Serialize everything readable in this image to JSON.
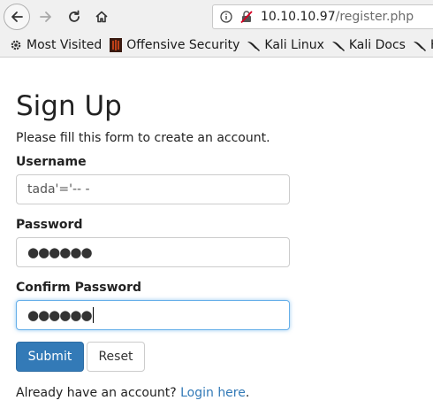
{
  "browser": {
    "url_host": "10.10.10.97",
    "url_path": "/register.php",
    "bookmarks": [
      {
        "label": "Most Visited",
        "icon": "gear-icon"
      },
      {
        "label": "Offensive Security",
        "icon": "offsec-icon"
      },
      {
        "label": "Kali Linux",
        "icon": "kali-dragon-icon"
      },
      {
        "label": "Kali Docs",
        "icon": "kali-dragon-icon"
      },
      {
        "label": "K",
        "icon": "kali-dragon-icon"
      }
    ]
  },
  "form": {
    "title": "Sign Up",
    "subtitle": "Please fill this form to create an account.",
    "username_label": "Username",
    "username_value": "tada'='-- -",
    "password_label": "Password",
    "password_value": "●●●●●●",
    "confirm_label": "Confirm Password",
    "confirm_value": "●●●●●●",
    "submit_label": "Submit",
    "reset_label": "Reset",
    "login_prompt": "Already have an account?",
    "login_link": "Login here",
    "login_suffix": "."
  },
  "colors": {
    "primary": "#337ab7",
    "focus": "#66afe9",
    "toolbar": "#f0f0f0"
  }
}
